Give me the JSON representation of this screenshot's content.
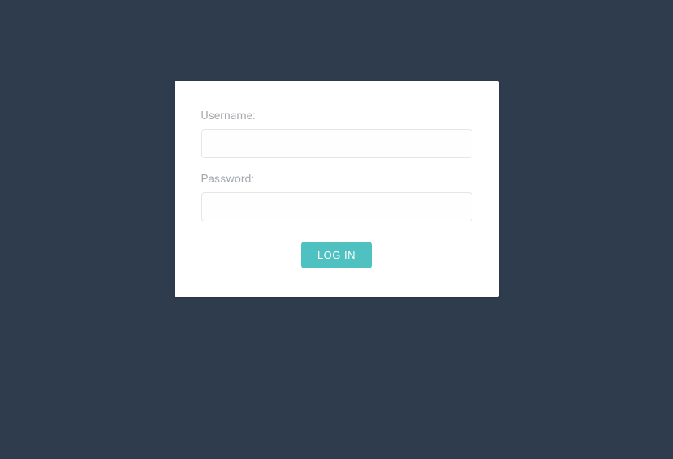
{
  "form": {
    "username_label": "Username:",
    "username_value": "",
    "password_label": "Password:",
    "password_value": "",
    "submit_label": "LOG IN"
  },
  "colors": {
    "page_bg": "#2f3c4e",
    "card_bg": "#ffffff",
    "button_bg": "#4fc1c1",
    "label_text": "#a5a9ae",
    "input_border": "#e4e7ea"
  }
}
